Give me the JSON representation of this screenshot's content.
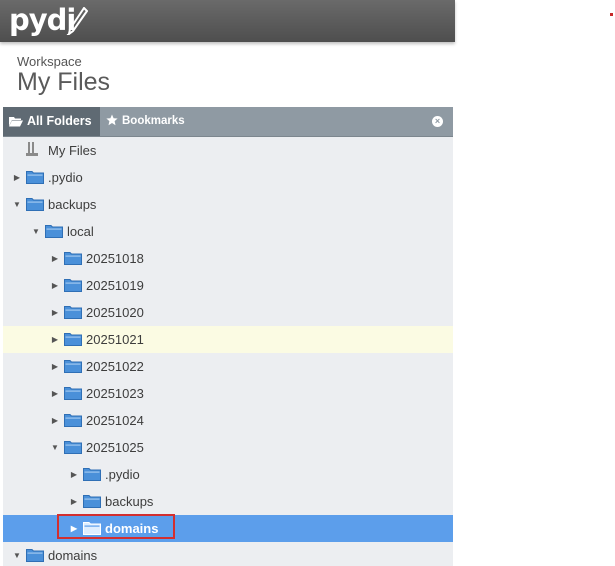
{
  "app": {
    "logo_text": "pydi",
    "workspace_label": "Workspace",
    "workspace_title": "My Files"
  },
  "tabs": {
    "all_folders": "All Folders",
    "bookmarks": "Bookmarks",
    "close_glyph": "×"
  },
  "tree": [
    {
      "label": "My Files",
      "icon": "root-icon",
      "toggle": ""
    },
    {
      "label": ".pydio",
      "icon": "folder-icon",
      "toggle": "collapsed"
    },
    {
      "label": "backups",
      "icon": "folder-icon",
      "toggle": "expanded"
    },
    {
      "label": "local",
      "icon": "folder-icon",
      "toggle": "expanded"
    },
    {
      "label": "20251018",
      "icon": "folder-icon",
      "toggle": "collapsed"
    },
    {
      "label": "20251019",
      "icon": "folder-icon",
      "toggle": "collapsed"
    },
    {
      "label": "20251020",
      "icon": "folder-icon",
      "toggle": "collapsed"
    },
    {
      "label": "20251021",
      "icon": "folder-icon",
      "toggle": "collapsed",
      "state": "hover"
    },
    {
      "label": "20251022",
      "icon": "folder-icon",
      "toggle": "collapsed"
    },
    {
      "label": "20251023",
      "icon": "folder-icon",
      "toggle": "collapsed"
    },
    {
      "label": "20251024",
      "icon": "folder-icon",
      "toggle": "collapsed"
    },
    {
      "label": "20251025",
      "icon": "folder-icon",
      "toggle": "expanded"
    },
    {
      "label": ".pydio",
      "icon": "folder-icon",
      "toggle": "collapsed"
    },
    {
      "label": "backups",
      "icon": "folder-icon",
      "toggle": "collapsed"
    },
    {
      "label": "domains",
      "icon": "folder-icon",
      "toggle": "collapsed",
      "state": "selected"
    },
    {
      "label": "domains",
      "icon": "folder-icon",
      "toggle": "expanded"
    }
  ],
  "colors": {
    "topbar": "#5c5c5c",
    "tabbar": "#8f9aa3",
    "tree_bg": "#eceef1",
    "selected": "#5c9eeb",
    "hover": "#fbfbe3",
    "folder": "#4a90d9",
    "highlight_box": "#d32f2f"
  }
}
